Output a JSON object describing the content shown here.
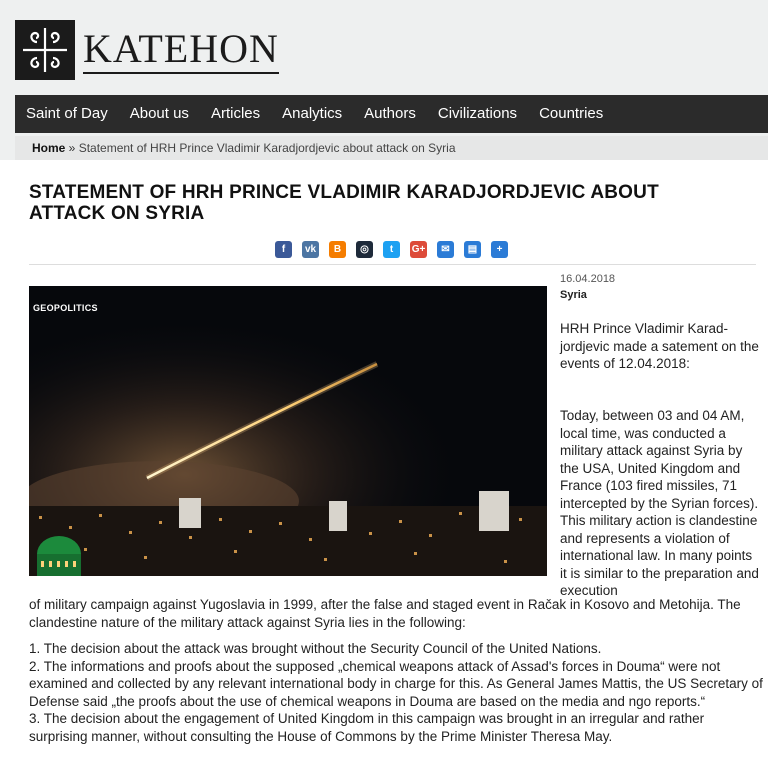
{
  "site": {
    "logo_text": "KATEHON"
  },
  "nav": [
    "Saint of Day",
    "About us",
    "Articles",
    "Analytics",
    "Authors",
    "Civilizations",
    "Countries"
  ],
  "breadcrumb": {
    "home": "Home",
    "separator": " » ",
    "current": "Statement of HRH Prince Vladimir Karadjordjevic about attack on Syria"
  },
  "article": {
    "title": "STATEMENT OF HRH PRINCE VLADIMIR KARADJORDJEVIC ABOUT ATTACK ON SYRIA",
    "date": "16.04.2018",
    "category": "Syria",
    "photo_label": "GEOPOLITICS",
    "intro": "HRH Prince Vladimir Karad-jordjevic made a satement on the events of 12.04.2018:",
    "body_side": "Today, between 03 and 04 AM, local time, was conducted a military attack against Syria by the USA, United Kingdom and France (103 fired missiles, 71 intercepted by the Syrian forces). This military action is clandestine and represents a violation of international law. In many points it is similar to the preparation and execution",
    "body_cont": "of military campaign against Yugoslavia in 1999, after the false and staged event in Račak in Kosovo and Metohija. The clandestine nature of the military attack against Syria lies in the following:",
    "points": [
      "1. The decision about the attack was brought without the Security Council of the United Nations.",
      "2. The informations and proofs about the supposed „chemical weapons attack of Assad's forces in Douma“ were not examined and collected by any relevant international body in charge for this. As General James Mattis, the US Secretary of Defense said „the proofs about the use of chemical weapons in Douma are based on the media and ngo reports.“",
      "3. The decision about the engagement of United Kingdom in this campaign was brought in an irregular and rather surprising manner, without consulting the House of Commons by the Prime Minister Theresa May."
    ]
  },
  "share_icons": [
    {
      "name": "facebook-icon",
      "glyph": "f",
      "color": "#3b5998"
    },
    {
      "name": "vk-icon",
      "glyph": "vk",
      "color": "#4c75a3"
    },
    {
      "name": "blogger-icon",
      "glyph": "B",
      "color": "#f57d00"
    },
    {
      "name": "livejournal-icon",
      "glyph": "◎",
      "color": "#1e2a3a"
    },
    {
      "name": "twitter-icon",
      "glyph": "t",
      "color": "#1da1f2"
    },
    {
      "name": "google-plus-icon",
      "glyph": "G+",
      "color": "#dd4b39"
    },
    {
      "name": "email-icon",
      "glyph": "✉",
      "color": "#2b7bd6"
    },
    {
      "name": "print-icon",
      "glyph": "▤",
      "color": "#2b7bd6"
    },
    {
      "name": "more-share-icon",
      "glyph": "+",
      "color": "#2b7bd6"
    }
  ]
}
